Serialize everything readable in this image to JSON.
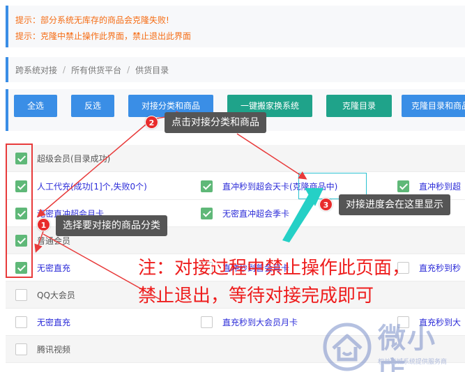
{
  "notices": [
    "提示：部分系统无库存的商品会克隆失败!",
    "提示：克隆中禁止操作此界面，禁止退出此界面"
  ],
  "breadcrumb": [
    "跨系统对接",
    "所有供货平台",
    "供货目录"
  ],
  "toolbar": {
    "select_all": "全选",
    "invert": "反选",
    "dock_category": "对接分类和商品",
    "one_click_move": "一键搬家换系统",
    "clone_catalog": "克隆目录",
    "clone_catalog_and_goods": "克隆目录和商品"
  },
  "rows": {
    "group1": "超级会员(目录成功)",
    "r2": [
      "人工代充(成功[1]个,失败0个)",
      "直冲秒到超会天卡(克隆商品中)",
      "直冲秒到超"
    ],
    "r3": [
      "无密直冲超会月卡",
      "无密直冲超会季卡"
    ],
    "group2": "普通会员",
    "r5": [
      "无密直充",
      "直冲秒到普会月卡",
      "直充秒到秒"
    ],
    "group3": "QQ大会员",
    "r7": [
      "无密直充",
      "直充秒到大会员月卡",
      "直充秒到大"
    ],
    "group4": "腾讯视频"
  },
  "annotations": {
    "marker1": "1",
    "tip1": "选择要对接的商品分类",
    "marker2": "2",
    "tip2": "点击对接分类和商品",
    "marker3": "3",
    "tip3": "对接进度会在这里显示",
    "note_line1": "注：对接过程中禁止操作此页面，",
    "note_line2": "禁止退出，等待对接完成即可"
  },
  "watermark": {
    "name": "微小店",
    "sub": "权益商城系统提供服务商"
  },
  "colors": {
    "primary": "#3a8ee6",
    "teal": "#1fa38a",
    "warning": "#f56c14",
    "checked": "#5fb878",
    "annotation_red": "#e82b2b",
    "annotation_cyan": "#29c1d0"
  }
}
